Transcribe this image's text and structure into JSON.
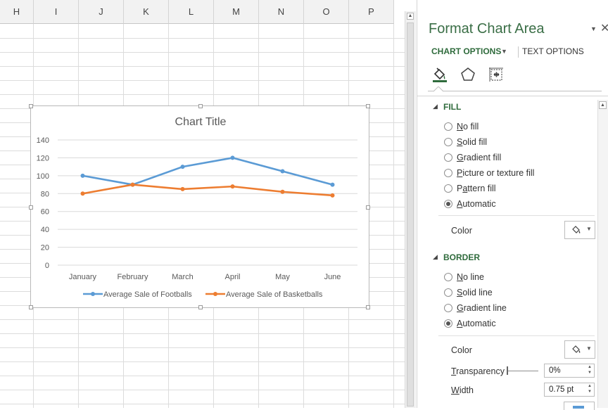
{
  "sheet": {
    "columns": [
      "H",
      "I",
      "J",
      "K",
      "L",
      "M",
      "N",
      "O",
      "P"
    ]
  },
  "chart_data": {
    "type": "line",
    "title": "Chart Title",
    "categories": [
      "January",
      "February",
      "March",
      "April",
      "May",
      "June"
    ],
    "series": [
      {
        "name": "Average Sale of Footballs",
        "color": "#5b9bd5",
        "values": [
          100,
          90,
          110,
          120,
          105,
          90
        ]
      },
      {
        "name": "Average Sale of Basketballs",
        "color": "#ed7d31",
        "values": [
          80,
          90,
          85,
          88,
          82,
          78
        ]
      }
    ],
    "ylim": [
      0,
      140
    ],
    "yticks": [
      "0",
      "20",
      "40",
      "60",
      "80",
      "100",
      "120",
      "140"
    ],
    "grid": true,
    "legend": "bottom"
  },
  "panel": {
    "title": "Format Chart Area",
    "tabs": {
      "chart_options": "CHART OPTIONS",
      "text_options": "TEXT OPTIONS"
    },
    "icons": [
      "fill-line-icon",
      "effects-pentagon-icon",
      "size-properties-icon"
    ],
    "fill": {
      "header": "FILL",
      "options": [
        {
          "pre": "",
          "ul": "N",
          "post": "o fill",
          "selected": false
        },
        {
          "pre": "",
          "ul": "S",
          "post": "olid fill",
          "selected": false
        },
        {
          "pre": "",
          "ul": "G",
          "post": "radient fill",
          "selected": false
        },
        {
          "pre": "",
          "ul": "P",
          "post": "icture or texture fill",
          "selected": false
        },
        {
          "pre": "P",
          "ul": "a",
          "post": "ttern fill",
          "selected": false
        },
        {
          "pre": "",
          "ul": "A",
          "post": "utomatic",
          "selected": true
        }
      ],
      "color_label": "Color"
    },
    "border": {
      "header": "BORDER",
      "options": [
        {
          "pre": "",
          "ul": "N",
          "post": "o line",
          "selected": false
        },
        {
          "pre": "",
          "ul": "S",
          "post": "olid line",
          "selected": false
        },
        {
          "pre": "",
          "ul": "G",
          "post": "radient line",
          "selected": false
        },
        {
          "pre": "",
          "ul": "A",
          "post": "utomatic",
          "selected": true
        }
      ],
      "color_label": "Color",
      "transparency": {
        "ul": "T",
        "post": "ransparency",
        "value": "0%"
      },
      "width": {
        "ul": "W",
        "post": "idth",
        "value": "0.75 pt"
      }
    }
  }
}
